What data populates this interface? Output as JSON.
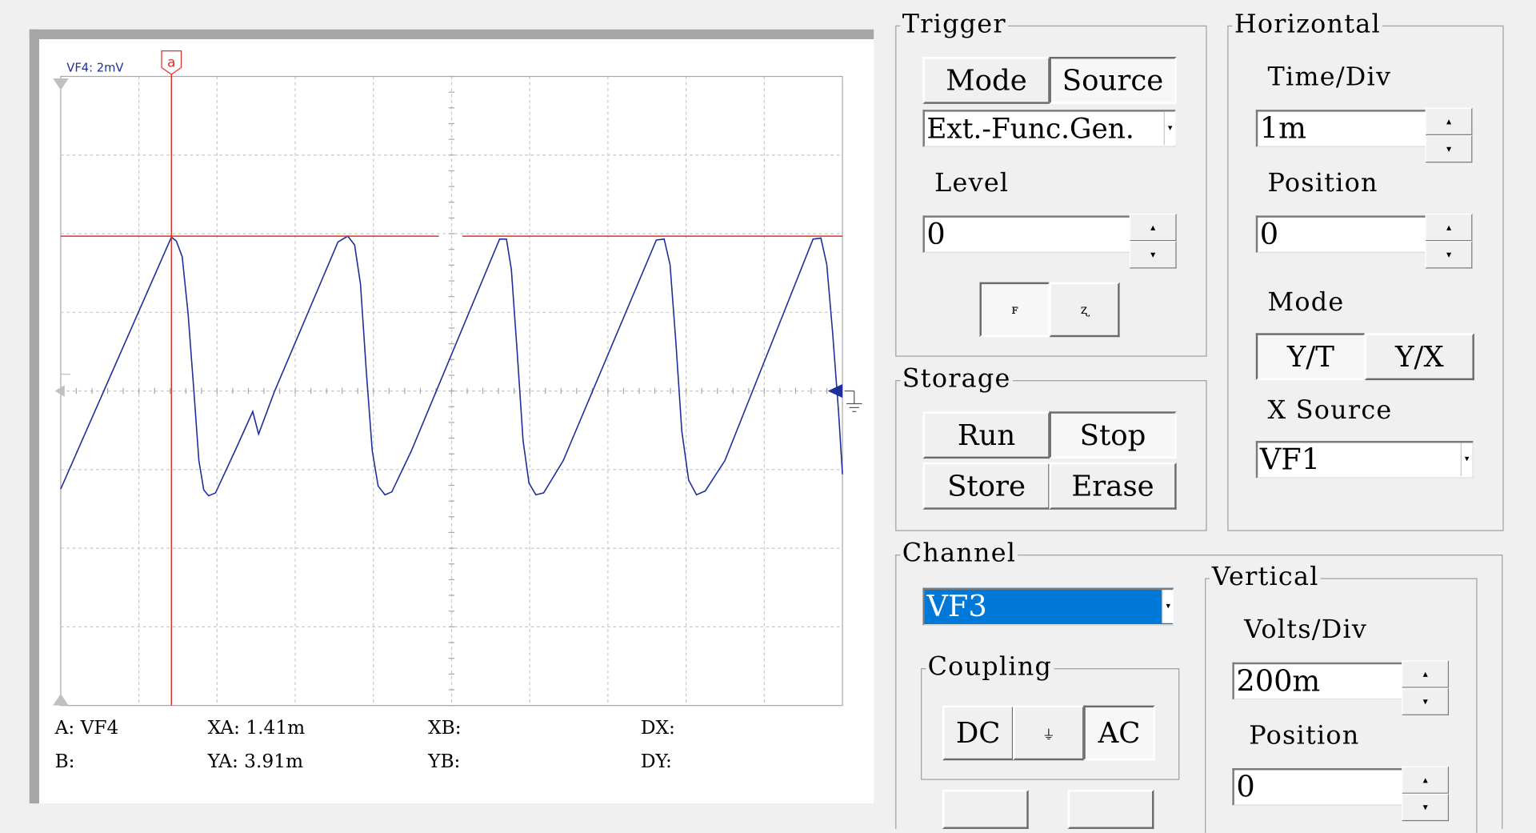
{
  "scope": {
    "channel_label": "VF4: 2mV",
    "cursor_a_label": "a",
    "readouts": {
      "a": "A: VF4",
      "b": "B:",
      "xa": "XA: 1.41m",
      "ya": "YA: 3.91m",
      "xb": "XB:",
      "yb": "YB:",
      "dx": "DX:",
      "dy": "DY:"
    },
    "colors": {
      "trace": "#1d2f9b",
      "cursor": "#e0302a",
      "grid": "#c8c8c8",
      "axis": "#a8a8a8"
    }
  },
  "trigger": {
    "title": "Trigger",
    "mode_label": "Mode",
    "source_label": "Source",
    "source_value": "Ext.-Func.Gen.",
    "level_label": "Level",
    "level_value": "0",
    "rise_icon": "rising-edge-icon",
    "fall_icon": "falling-edge-icon"
  },
  "horizontal": {
    "title": "Horizontal",
    "timediv_label": "Time/Div",
    "timediv_value": "1m",
    "position_label": "Position",
    "position_value": "0",
    "mode_label": "Mode",
    "yt_label": "Y/T",
    "yx_label": "Y/X",
    "xsource_label": "X Source",
    "xsource_value": "VF1"
  },
  "storage": {
    "title": "Storage",
    "run_label": "Run",
    "stop_label": "Stop",
    "store_label": "Store",
    "erase_label": "Erase"
  },
  "channel": {
    "title": "Channel",
    "value": "VF3",
    "coupling_title": "Coupling",
    "dc_label": "DC",
    "gnd_icon": "ground-icon",
    "ac_label": "AC"
  },
  "vertical": {
    "title": "Vertical",
    "voltsdiv_label": "Volts/Div",
    "voltsdiv_value": "200m",
    "position_label": "Position",
    "position_value": "0"
  }
}
